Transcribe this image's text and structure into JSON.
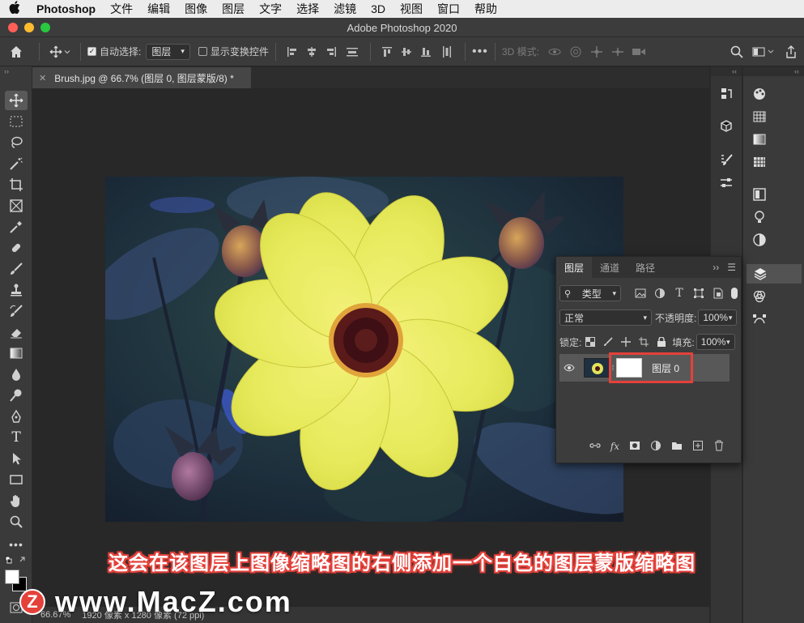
{
  "menubar": {
    "app": "Photoshop",
    "items": [
      "文件",
      "编辑",
      "图像",
      "图层",
      "文字",
      "选择",
      "滤镜",
      "3D",
      "视图",
      "窗口",
      "帮助"
    ]
  },
  "window": {
    "title": "Adobe Photoshop 2020"
  },
  "options_bar": {
    "auto_select_label": "自动选择:",
    "auto_select_value": "图层",
    "show_transform_label": "显示变换控件",
    "mode_3d_label": "3D 模式:"
  },
  "document_tab": {
    "title": "Brush.jpg @ 66.7% (图层 0, 图层蒙版/8) *"
  },
  "status_bar": {
    "zoom": "66.67%",
    "size": "1920 像素 x 1280 像素 (72 ppi)"
  },
  "layers_panel": {
    "tabs": [
      "图层",
      "通道",
      "路径"
    ],
    "filter_label": "类型",
    "blend_mode": "正常",
    "opacity_label": "不透明度:",
    "opacity_value": "100%",
    "lock_label": "锁定:",
    "fill_label": "填充:",
    "fill_value": "100%",
    "layer_name": "图层 0"
  },
  "caption": "这会在该图层上图像缩略图的右侧添加一个白色的图层蒙版缩略图",
  "watermark": {
    "logo": "Z",
    "text": "www.MacZ.com"
  },
  "colors": {
    "accent_red": "#e4413a",
    "panel_bg": "#3c3c3c"
  }
}
